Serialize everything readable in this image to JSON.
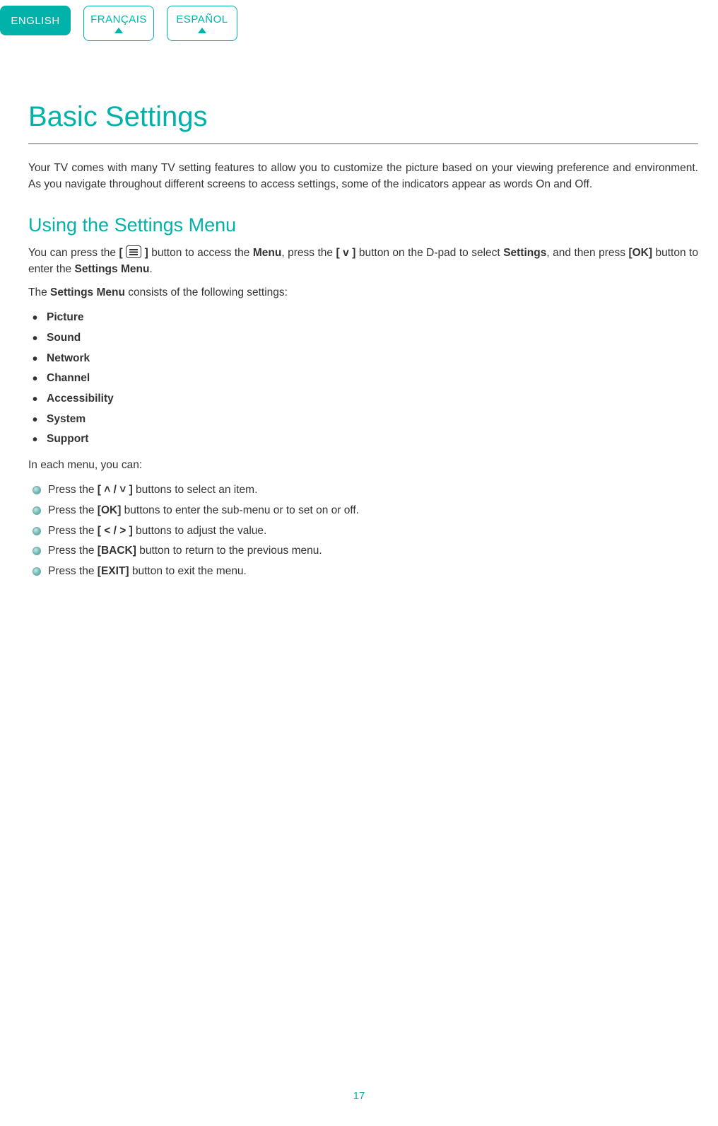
{
  "tabs": {
    "english": "ENGLISH",
    "francais": "FRANÇAIS",
    "espanol": "ESPAÑOL"
  },
  "headings": {
    "title": "Basic Settings",
    "subtitle": "Using the Settings Menu"
  },
  "intro": "Your TV comes with many TV setting features to allow you to customize the picture based on your viewing preference and environment. As you navigate throughout different screens to access settings, some of the indicators appear as words On and Off.",
  "para1": {
    "pre": "You can press the ",
    "b1": "[",
    "b2": "]",
    "mid1": " button to access the ",
    "menu": "Menu",
    "mid2": ", press the ",
    "vbtn": "[ v ]",
    "mid3": " button on the D-pad to select ",
    "settings": "Settings",
    "mid4": ", and then press ",
    "ok": "[OK]",
    "mid5": " button to enter the ",
    "sm": "Settings Menu",
    "end": "."
  },
  "para2": {
    "pre": "The ",
    "sm": "Settings Menu",
    "post": " consists of the following settings:"
  },
  "settings_list": [
    "Picture",
    "Sound",
    "Network",
    "Channel",
    "Accessibility",
    "System",
    "Support"
  ],
  "para3": "In each menu, you can:",
  "actions": [
    {
      "pre": "Press the ",
      "b": "[ ˄ / ˅ ]",
      "post": " buttons to select an item."
    },
    {
      "pre": "Press the ",
      "b": "[OK]",
      "post": " buttons to enter the sub-menu or to set on or off."
    },
    {
      "pre": "Press the ",
      "b": "[ < / > ]",
      "post": " buttons to adjust the value."
    },
    {
      "pre": "Press the ",
      "b": "[BACK]",
      "post": " button to return to the previous menu."
    },
    {
      "pre": "Press the ",
      "b": "[EXIT]",
      "post": " button to exit the menu."
    }
  ],
  "page_number": "17"
}
